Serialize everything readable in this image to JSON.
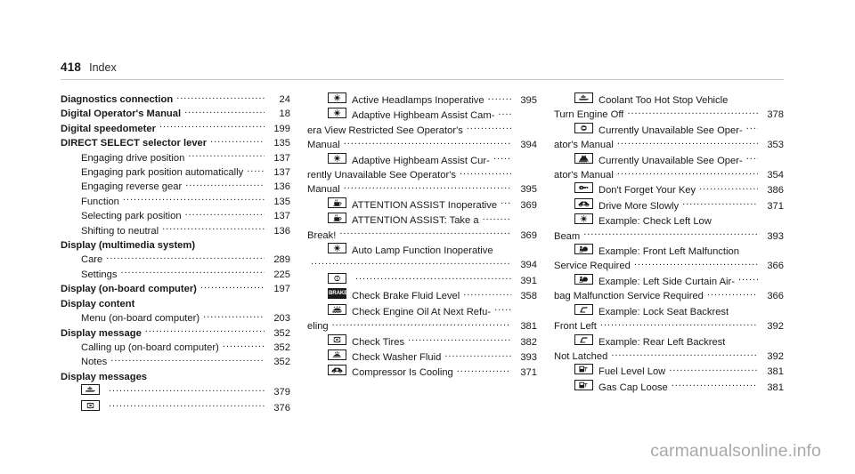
{
  "header": {
    "folio": "418",
    "section": "Index"
  },
  "watermark": "carmanualsonline.info",
  "columns": [
    {
      "id": "column-1",
      "entries": [
        {
          "kind": "entry",
          "level": 1,
          "label": "Diagnostics connection",
          "page": "24"
        },
        {
          "kind": "entry",
          "level": 1,
          "label": "Digital Operator's Manual",
          "page": "18"
        },
        {
          "kind": "entry",
          "level": 1,
          "label": "Digital speedometer",
          "page": "199"
        },
        {
          "kind": "entry",
          "level": 1,
          "label": "DIRECT SELECT selector lever",
          "page": "135"
        },
        {
          "kind": "entry",
          "level": 2,
          "label": "Engaging drive position",
          "page": "137"
        },
        {
          "kind": "entry",
          "level": 2,
          "label": "Engaging park position automatically",
          "page": "137"
        },
        {
          "kind": "entry",
          "level": 2,
          "label": "Engaging reverse gear",
          "page": "136"
        },
        {
          "kind": "entry",
          "level": 2,
          "label": "Function",
          "page": "135"
        },
        {
          "kind": "entry",
          "level": 2,
          "label": "Selecting park position",
          "page": "137"
        },
        {
          "kind": "entry",
          "level": 2,
          "label": "Shifting to neutral",
          "page": "136"
        },
        {
          "kind": "heading",
          "level": 1,
          "label": "Display (multimedia system)"
        },
        {
          "kind": "entry",
          "level": 2,
          "label": "Care",
          "page": "289"
        },
        {
          "kind": "entry",
          "level": 2,
          "label": "Settings",
          "page": "225"
        },
        {
          "kind": "entry",
          "level": 1,
          "label": "Display (on-board computer)",
          "page": "197"
        },
        {
          "kind": "heading",
          "level": 1,
          "label": "Display content"
        },
        {
          "kind": "entry",
          "level": 2,
          "label": "Menu (on-board computer)",
          "page": "203"
        },
        {
          "kind": "entry",
          "level": 1,
          "label": "Display message",
          "page": "352"
        },
        {
          "kind": "entry",
          "level": 2,
          "label": "Calling up (on-board computer)",
          "page": "352"
        },
        {
          "kind": "entry",
          "level": 2,
          "label": "Notes",
          "page": "352"
        },
        {
          "kind": "heading",
          "level": 1,
          "label": "Display messages"
        },
        {
          "kind": "iconentry",
          "icon": "coolant-temperature-icon",
          "label": "",
          "page": "379"
        },
        {
          "kind": "iconentry",
          "icon": "tire-pressure-icon",
          "label": "",
          "page": "376"
        }
      ]
    },
    {
      "id": "column-2",
      "entries": [
        {
          "kind": "iconentry",
          "icon": "headlamp-icon",
          "label": "Active Headlamps Inoperative",
          "page": "395"
        },
        {
          "kind": "iconentry",
          "icon": "headlamp-icon",
          "label": "Adaptive Highbeam Assist Cam-",
          "page": ""
        },
        {
          "kind": "cont",
          "label": "era View Restricted See Operator's",
          "page": ""
        },
        {
          "kind": "cont",
          "label": "Manual",
          "page": "394"
        },
        {
          "kind": "iconentry",
          "icon": "headlamp-icon",
          "label": "Adaptive Highbeam Assist Cur-",
          "page": ""
        },
        {
          "kind": "cont",
          "label": "rently Unavailable See Operator's",
          "page": ""
        },
        {
          "kind": "cont",
          "label": "Manual",
          "page": "395"
        },
        {
          "kind": "iconentry",
          "icon": "coffee-cup-icon",
          "label": "ATTENTION ASSIST Inoperative",
          "page": "369"
        },
        {
          "kind": "iconentry",
          "icon": "coffee-cup-icon",
          "label": "ATTENTION ASSIST: Take a",
          "page": ""
        },
        {
          "kind": "cont",
          "label": "Break!",
          "page": "369"
        },
        {
          "kind": "iconentry",
          "icon": "headlamp-icon",
          "label": "Auto Lamp Function Inoperative",
          "page": "",
          "noleader": true
        },
        {
          "kind": "cont",
          "label": "",
          "page": "394"
        },
        {
          "kind": "iconentry",
          "icon": "brake-wear-icon",
          "label": "",
          "page": "391"
        },
        {
          "kind": "iconentry",
          "icon": "brake-text-icon",
          "label": "Check Brake Fluid Level",
          "page": "358"
        },
        {
          "kind": "iconentry",
          "icon": "engine-oil-icon",
          "label": "Check Engine Oil At Next Refu-",
          "page": ""
        },
        {
          "kind": "cont",
          "label": "eling",
          "page": "381"
        },
        {
          "kind": "iconentry",
          "icon": "tire-pressure-icon",
          "label": "Check Tires",
          "page": "382"
        },
        {
          "kind": "iconentry",
          "icon": "washer-fluid-icon",
          "label": "Check Washer Fluid",
          "page": "393"
        },
        {
          "kind": "iconentry",
          "icon": "car-ac-icon",
          "label": "Compressor Is Cooling",
          "page": "371"
        }
      ]
    },
    {
      "id": "column-3",
      "entries": [
        {
          "kind": "iconentry",
          "icon": "coolant-temperature-icon",
          "label": "Coolant Too Hot Stop Vehicle",
          "page": "",
          "noleader": true
        },
        {
          "kind": "cont",
          "label": "Turn Engine Off",
          "page": "378"
        },
        {
          "kind": "iconentry",
          "icon": "steering-wheel-icon",
          "label": "Currently Unavailable See Oper-",
          "page": ""
        },
        {
          "kind": "cont",
          "label": "ator's Manual",
          "page": "353"
        },
        {
          "kind": "iconentry",
          "icon": "parking-brake-icon",
          "label": "Currently Unavailable See Oper-",
          "page": ""
        },
        {
          "kind": "cont",
          "label": "ator's Manual",
          "page": "354"
        },
        {
          "kind": "iconentry",
          "icon": "key-icon",
          "label": "Don't Forget Your Key",
          "page": "386"
        },
        {
          "kind": "iconentry",
          "icon": "car-ac-icon",
          "label": "Drive More Slowly",
          "page": "371"
        },
        {
          "kind": "iconentry",
          "icon": "headlamp-icon",
          "label": "Example: Check Left Low",
          "page": "",
          "noleader": true
        },
        {
          "kind": "cont",
          "label": "Beam",
          "page": "393"
        },
        {
          "kind": "iconentry",
          "icon": "airbag-icon",
          "label": "Example: Front Left Malfunction",
          "page": "",
          "noleader": true
        },
        {
          "kind": "cont",
          "label": "Service Required",
          "page": "366"
        },
        {
          "kind": "iconentry",
          "icon": "airbag-icon",
          "label": "Example: Left Side Curtain Air-",
          "page": ""
        },
        {
          "kind": "cont",
          "label": "bag Malfunction Service Required",
          "page": "366"
        },
        {
          "kind": "iconentry",
          "icon": "seat-backrest-icon",
          "label": "Example: Lock Seat Backrest",
          "page": "",
          "noleader": true
        },
        {
          "kind": "cont",
          "label": "Front Left",
          "page": "392"
        },
        {
          "kind": "iconentry",
          "icon": "seat-backrest-icon",
          "label": "Example: Rear Left Backrest",
          "page": "",
          "noleader": true
        },
        {
          "kind": "cont",
          "label": "Not Latched",
          "page": "392"
        },
        {
          "kind": "iconentry",
          "icon": "fuel-pump-icon",
          "label": "Fuel Level Low",
          "page": "381"
        },
        {
          "kind": "iconentry",
          "icon": "fuel-pump-icon",
          "label": "Gas Cap Loose",
          "page": "381"
        }
      ]
    }
  ]
}
